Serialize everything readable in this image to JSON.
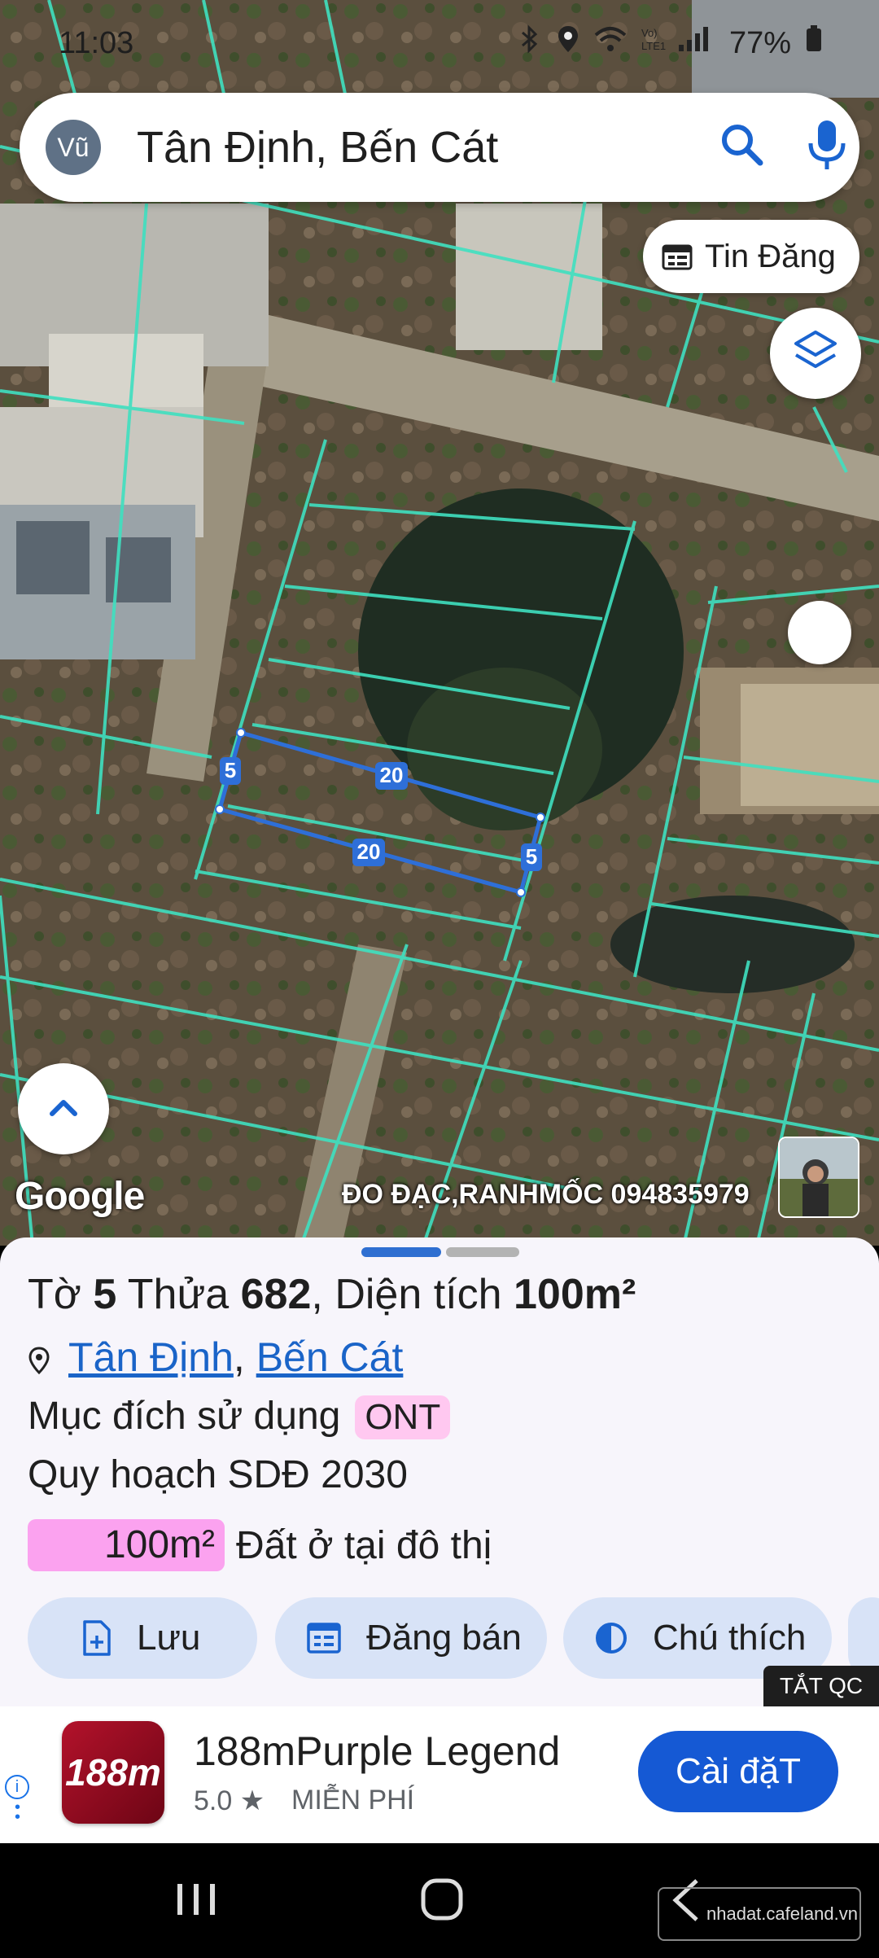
{
  "status_bar": {
    "time": "11:03",
    "battery": "77%"
  },
  "search": {
    "avatar": "Vũ",
    "query": "Tân Định, Bến Cát"
  },
  "listing_chip": {
    "label": "Tin Đăng"
  },
  "plot": {
    "side_top": "20",
    "side_bottom": "20",
    "side_left": "5",
    "side_right": "5"
  },
  "map": {
    "attribution": "Google",
    "watermark": "ĐO ĐẠC,RANHMỐC 094835979"
  },
  "parcel": {
    "to_label": "Tờ",
    "to_value": "5",
    "thua_label": "Thửa",
    "thua_value": "682",
    "area_label": "Diện tích",
    "area_value": "100m²",
    "ward": "Tân Định",
    "district": "Bến Cát",
    "purpose_label": "Mục đích sử dụng",
    "purpose_code": "ONT",
    "plan_label": "Quy hoạch SDĐ 2030",
    "land_area": "100m²",
    "land_type": "Đất ở tại đô thị"
  },
  "actions": {
    "save": "Lưu",
    "sell": "Đăng bán",
    "legend": "Chú thích"
  },
  "ad": {
    "close_label": "TẮT QC",
    "app_icon_text": "188m",
    "app_name": "188mPurple Legend",
    "rating": "5.0 ★",
    "price": "MIỄN PHÍ",
    "install": "Cài đặT"
  },
  "footer_logo": "nhadat.cafeland.vn",
  "colors": {
    "boundary": "#3fe0c0",
    "plot_outline": "#2e6fd8",
    "accent": "#1559d4",
    "ont_badge": "#ffc8f0"
  }
}
